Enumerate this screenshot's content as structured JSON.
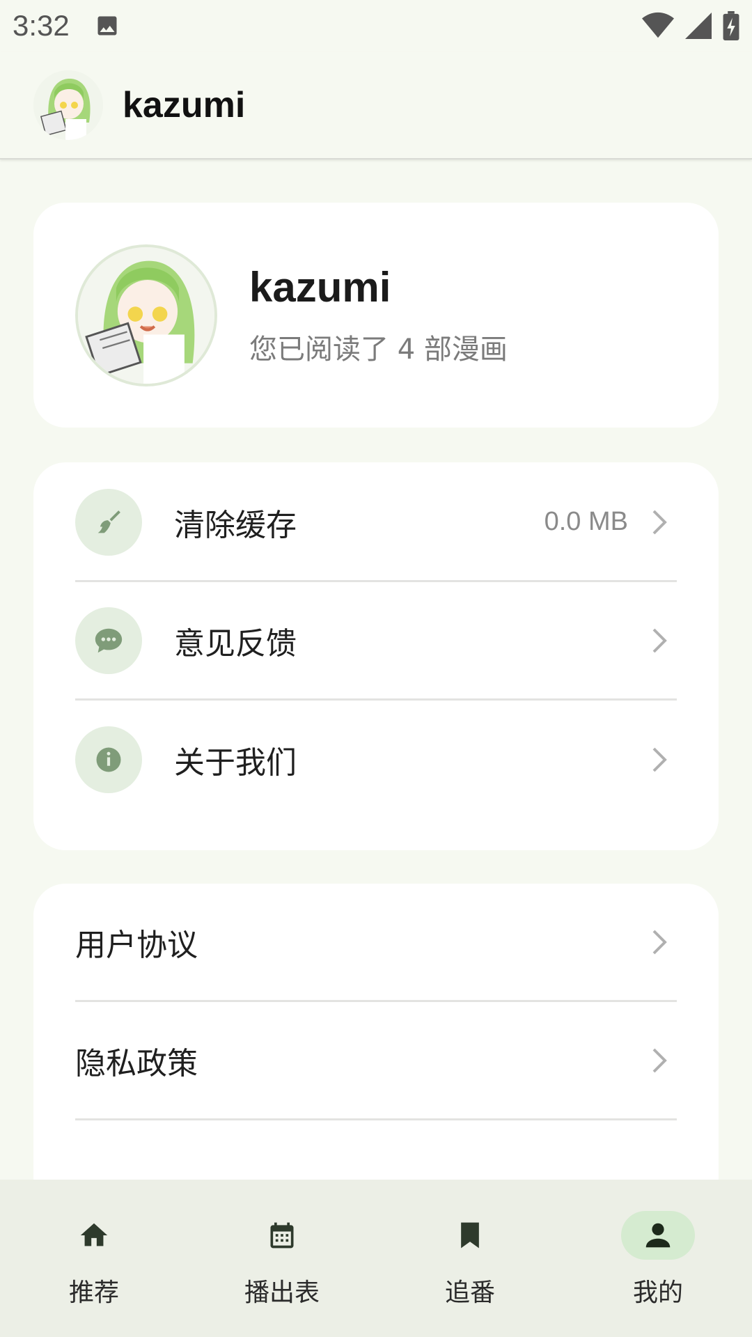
{
  "status_bar": {
    "time": "3:32"
  },
  "app_bar": {
    "title": "kazumi"
  },
  "profile": {
    "name": "kazumi",
    "subtitle": "您已阅读了 4 部漫画"
  },
  "settings": {
    "items": [
      {
        "label": "清除缓存",
        "value": "0.0 MB",
        "icon": "broom-icon"
      },
      {
        "label": "意见反馈",
        "icon": "chat-bubble-icon"
      },
      {
        "label": "关于我们",
        "icon": "info-icon"
      }
    ]
  },
  "legal": {
    "items": [
      {
        "label": "用户协议"
      },
      {
        "label": "隐私政策"
      }
    ]
  },
  "bottom_nav": {
    "items": [
      {
        "label": "推荐",
        "icon": "home-icon"
      },
      {
        "label": "播出表",
        "icon": "calendar-icon"
      },
      {
        "label": "追番",
        "icon": "bookmark-icon"
      },
      {
        "label": "我的",
        "icon": "person-icon",
        "active": true
      }
    ]
  },
  "colors": {
    "accent_bg": "#d5ebd0",
    "icon_circle": "#e4eee0",
    "icon_green": "#7f9c79",
    "background": "#f6f9f1"
  }
}
